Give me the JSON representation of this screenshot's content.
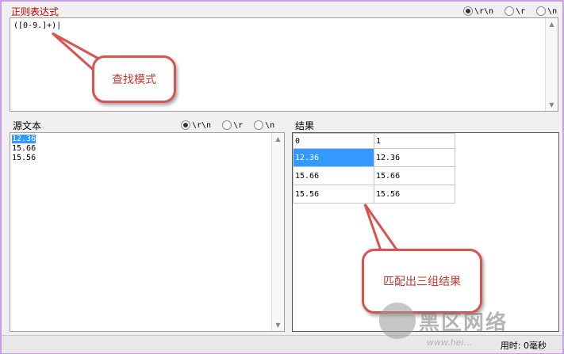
{
  "regex_panel": {
    "title": "正则表达式",
    "pattern": "([0-9.]+)|",
    "line_endings": [
      {
        "label": "\\r\\n",
        "selected": true
      },
      {
        "label": "\\r",
        "selected": false
      },
      {
        "label": "\\n",
        "selected": false
      }
    ]
  },
  "source_panel": {
    "title": "源文本",
    "lines": [
      "12.36",
      "15.66",
      "15.56"
    ],
    "line_endings": [
      {
        "label": "\\r\\n",
        "selected": true
      },
      {
        "label": "\\r",
        "selected": false
      },
      {
        "label": "\\n",
        "selected": false
      }
    ]
  },
  "result_panel": {
    "title": "结果",
    "columns": [
      "0",
      "1"
    ],
    "rows": [
      [
        "12.36",
        "12.36"
      ],
      [
        "15.66",
        "15.66"
      ],
      [
        "15.56",
        "15.56"
      ]
    ]
  },
  "status": {
    "text": "用时: 0毫秒"
  },
  "callouts": {
    "search_mode": "查找模式",
    "three_groups": "匹配出三组结果"
  },
  "watermark": {
    "main": "黑区网络",
    "sub": "www.hei..."
  },
  "colors": {
    "accent_red": "#d9534f",
    "selection": "#3399ff",
    "frame": "#c89fe0"
  }
}
